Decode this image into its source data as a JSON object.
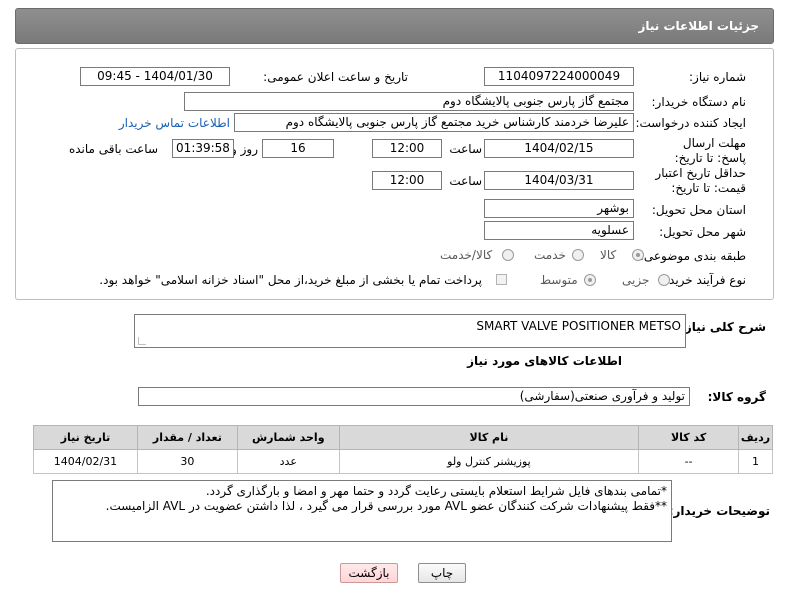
{
  "header": {
    "title": "جزئیات اطلاعات نیاز"
  },
  "form": {
    "need_number_label": "شماره نیاز:",
    "need_number": "1104097224000049",
    "announce_label": "تاریخ و ساعت اعلان عمومی:",
    "announce_value": "1404/01/30 - 09:45",
    "buyer_org_label": "نام دستگاه خریدار:",
    "buyer_org": "مجتمع گاز پارس جنوبی  پالایشگاه دوم",
    "creator_label": "ایجاد کننده درخواست:",
    "creator": "علیرضا خردمند کارشناس خرید مجتمع گاز پارس جنوبی  پالایشگاه دوم",
    "contact_link": "اطلاعات تماس خریدار",
    "deadline_label": "مهلت ارسال پاسخ: تا تاریخ:",
    "deadline_date": "1404/02/15",
    "hour_label": "ساعت",
    "deadline_time": "12:00",
    "days_value": "16",
    "days_label": "روز و",
    "remaining_time": "01:39:58",
    "remaining_label": "ساعت باقی مانده",
    "validity_label": "حداقل تاریخ اعتبار قیمت: تا تاریخ:",
    "validity_date": "1404/03/31",
    "validity_time": "12:00",
    "province_label": "استان محل تحویل:",
    "province": "بوشهر",
    "city_label": "شهر محل تحویل:",
    "city": "عسلویه",
    "category_label": "طبقه بندی موضوعی:",
    "category_options": [
      "کالا",
      "خدمت",
      "کالا/خدمت"
    ],
    "purchase_type_label": "نوع فرآیند خرید :",
    "purchase_options": [
      "جزیی",
      "متوسط"
    ],
    "payment_note": "پرداخت تمام یا بخشی از مبلغ خرید،از محل \"اسناد خزانه اسلامی\" خواهد بود."
  },
  "description": {
    "label": "شرح کلی نیاز:",
    "text": "SMART VALVE POSITIONER METSO"
  },
  "goods_info_title": "اطلاعات کالاهای مورد نیاز",
  "goods_group": {
    "label": "گروه کالا:",
    "value": "تولید و فرآوری صنعتی(سفارشی)"
  },
  "table": {
    "headers": [
      "ردیف",
      "کد کالا",
      "نام کالا",
      "واحد شمارش",
      "تعداد / مقدار",
      "تاریخ نیاز"
    ],
    "rows": [
      [
        "1",
        "--",
        "پوزیشنر کنترل ولو",
        "عدد",
        "30",
        "1404/02/31"
      ]
    ]
  },
  "notes": {
    "label": "توضیحات خریدار:",
    "line1": "*تمامی بندهای فایل شرایط استعلام بایستی رعایت گردد و حتما مهر و امضا و بارگذاری گردد.",
    "line2": "**فقط پیشنهادات شرکت کنندگان عضو AVL مورد بررسی قرار می گیرد ، لذا داشتن عضویت در AVL الزامیست."
  },
  "buttons": {
    "print": "چاپ",
    "back": "بازگشت"
  }
}
